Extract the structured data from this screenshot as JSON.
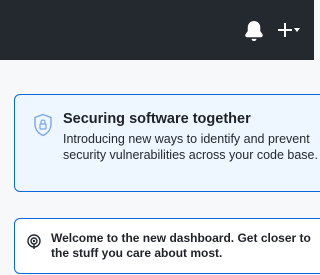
{
  "header": {
    "icons": [
      "bell-icon",
      "plus-icon",
      "caret-down-icon"
    ]
  },
  "security_card": {
    "icon": "shield-lock-icon",
    "title": "Securing software together",
    "description": "Introducing new ways to identify and prevent security vulnerabilities across your code base."
  },
  "welcome_card": {
    "icon": "broadcast-icon",
    "message": "Welcome to the new dashboard. Get closer to the stuff you care about most."
  },
  "colors": {
    "header_bg": "#24292f",
    "accent": "#0969da",
    "card_bg": "#eef6ff"
  }
}
